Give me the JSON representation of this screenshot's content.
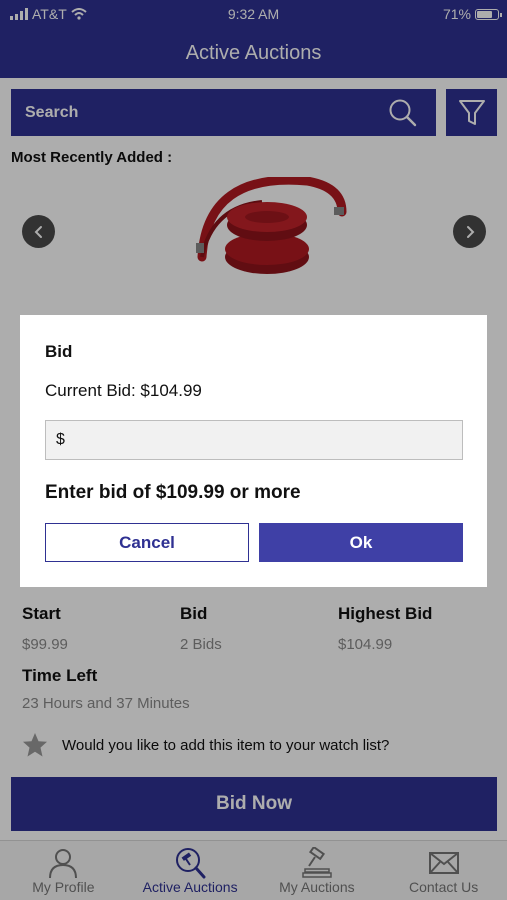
{
  "status_bar": {
    "carrier": "AT&T",
    "time": "9:32 AM",
    "battery": "71%"
  },
  "header": {
    "title": "Active Auctions"
  },
  "search": {
    "placeholder": "Search"
  },
  "section": {
    "title": "Most Recently Added :"
  },
  "item": {
    "start_label": "Start",
    "start_value": "$99.99",
    "bid_label": "Bid",
    "bid_value": "2 Bids",
    "highest_label": "Highest Bid",
    "highest_value": "$104.99",
    "time_left_label": "Time Left",
    "time_left_value": "23 Hours and 37 Minutes",
    "watch_prompt": "Would you like to add this item to your watch list?"
  },
  "actions": {
    "bid_now": "Bid Now"
  },
  "tabs": [
    {
      "label": "My Profile",
      "icon": "person-icon",
      "active": false
    },
    {
      "label": "Active Auctions",
      "icon": "search-gavel-icon",
      "active": true
    },
    {
      "label": "My Auctions",
      "icon": "gavel-icon",
      "active": false
    },
    {
      "label": "Contact Us",
      "icon": "envelope-icon",
      "active": false
    }
  ],
  "modal": {
    "title": "Bid",
    "current_bid": "Current Bid: $104.99",
    "input_placeholder": "$",
    "hint": "Enter bid of $109.99 or more",
    "cancel": "Cancel",
    "ok": "Ok"
  },
  "colors": {
    "brand": "#2f3192",
    "accent": "#3f40a6",
    "product": "#b11a21"
  }
}
